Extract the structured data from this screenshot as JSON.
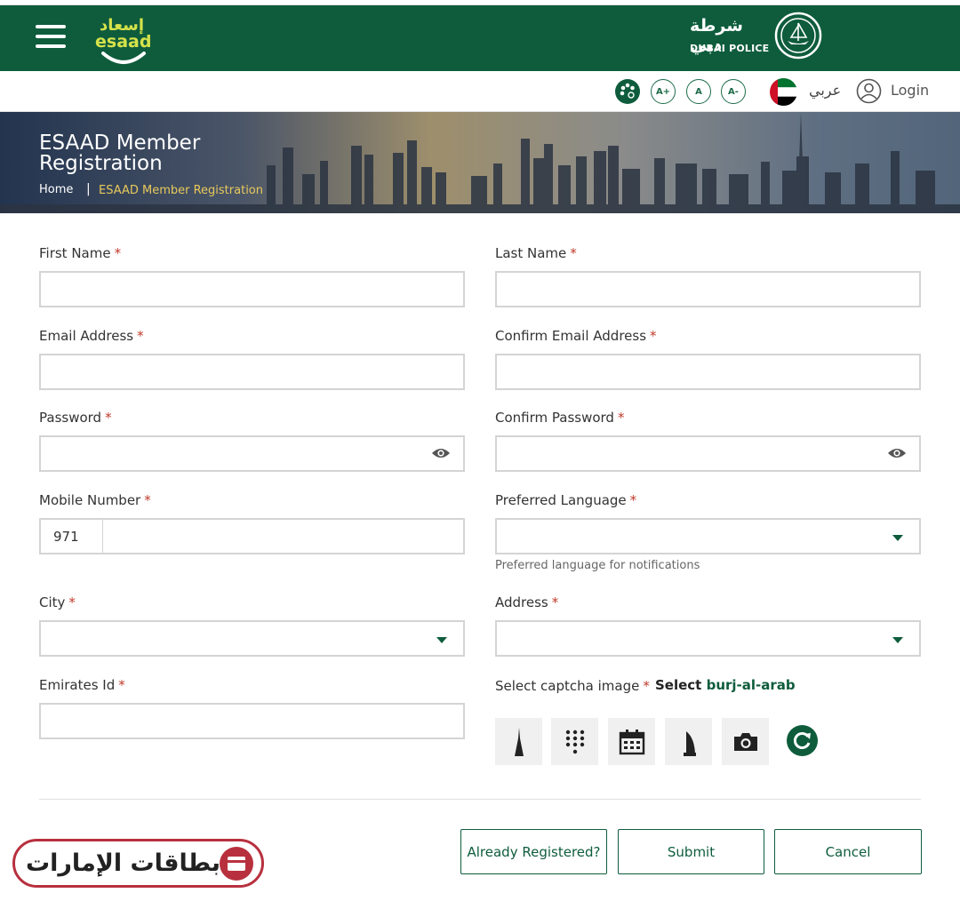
{
  "header": {
    "esaad_logo_ar": "إسعاد",
    "esaad_logo_en": "esaad",
    "police_logo_ar": "شرطة دبي",
    "police_logo_en": "DUBAI POLICE"
  },
  "utility": {
    "font_increase": "A+",
    "font_normal": "A",
    "font_decrease": "A-",
    "language": "عربي",
    "login": "Login"
  },
  "banner": {
    "title": "ESAAD Member Registration",
    "breadcrumb_home": "Home",
    "breadcrumb_separator": "|",
    "breadcrumb_current": "ESAAD Member Registration"
  },
  "form": {
    "first_name": {
      "label": "First Name",
      "value": ""
    },
    "last_name": {
      "label": "Last Name",
      "value": ""
    },
    "email": {
      "label": "Email Address",
      "value": ""
    },
    "confirm_email": {
      "label": "Confirm Email Address",
      "value": ""
    },
    "password": {
      "label": "Password",
      "value": ""
    },
    "confirm_password": {
      "label": "Confirm Password",
      "value": ""
    },
    "mobile": {
      "label": "Mobile Number",
      "prefix": "971",
      "value": ""
    },
    "preferred_language": {
      "label": "Preferred Language",
      "value": "",
      "hint": "Preferred language for notifications"
    },
    "city": {
      "label": "City",
      "value": ""
    },
    "address": {
      "label": "Address",
      "value": ""
    },
    "emirates_id": {
      "label": "Emirates Id",
      "value": ""
    },
    "required_mark": "*"
  },
  "captcha": {
    "label": "Select captcha image",
    "select_prefix": "Select",
    "select_target": "burj-al-arab",
    "icons": [
      "burj-khalifa-icon",
      "keypad-icon",
      "calendar-icon",
      "burj-al-arab-icon",
      "camera-icon"
    ]
  },
  "buttons": {
    "already_registered": "Already Registered?",
    "submit": "Submit",
    "cancel": "Cancel"
  },
  "watermark": {
    "text": "بطاقات الإمارات"
  },
  "colors": {
    "primary": "#0e5c3c",
    "required": "#c0392b",
    "breadcrumb": "#e8c95b",
    "watermark": "#b8303e"
  }
}
